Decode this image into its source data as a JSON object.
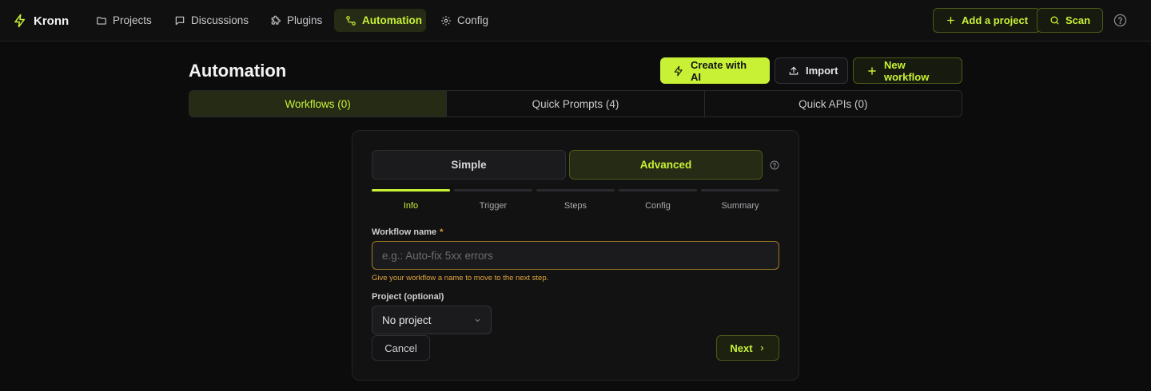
{
  "app": {
    "name": "Kronn"
  },
  "nav": {
    "items": [
      {
        "label": "Projects",
        "icon": "folder-icon"
      },
      {
        "label": "Discussions",
        "icon": "chat-icon"
      },
      {
        "label": "Plugins",
        "icon": "puzzle-icon"
      },
      {
        "label": "Automation",
        "icon": "workflow-icon",
        "active": true
      },
      {
        "label": "Config",
        "icon": "gear-icon"
      }
    ],
    "add_project_label": "Add a project",
    "scan_label": "Scan"
  },
  "page": {
    "title": "Automation",
    "create_ai_label": "Create with AI",
    "import_label": "Import",
    "new_workflow_label": "New workflow"
  },
  "tabs": [
    {
      "label": "Workflows (0)",
      "active": true
    },
    {
      "label": "Quick Prompts (4)"
    },
    {
      "label": "Quick APIs (0)"
    }
  ],
  "wizard": {
    "mode_simple": "Simple",
    "mode_advanced": "Advanced",
    "selected_mode": "Advanced",
    "steps": [
      {
        "label": "Info",
        "active": true
      },
      {
        "label": "Trigger"
      },
      {
        "label": "Steps"
      },
      {
        "label": "Config"
      },
      {
        "label": "Summary"
      }
    ],
    "name_label": "Workflow name",
    "required_mark": "*",
    "name_placeholder": "e.g.: Auto-fix 5xx errors",
    "name_value": "",
    "name_hint": "Give your workflow a name to move to the next step.",
    "project_label": "Project (optional)",
    "project_value": "No project",
    "cancel_label": "Cancel",
    "next_label": "Next"
  },
  "colors": {
    "accent": "#c8f135",
    "warning": "#e0a43a",
    "background": "#0c0c0d"
  }
}
